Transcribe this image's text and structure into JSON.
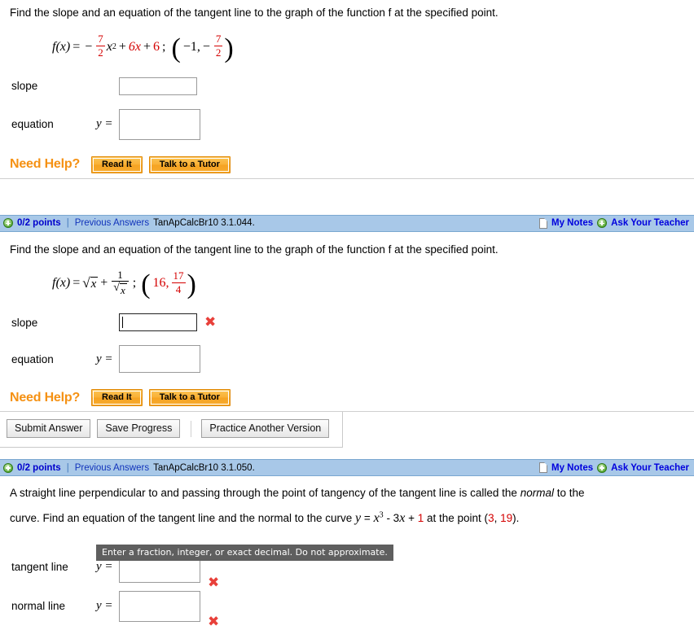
{
  "colors": {
    "header_bar": "#a8c8e8",
    "link": "#1133bb",
    "points": "#0000cc",
    "accent_orange": "#f59113",
    "math_red": "#d40000",
    "error_x": "#e8403a",
    "tooltip_bg": "#5f5f5f"
  },
  "problem1": {
    "prompt": "Find the slope and an equation of the tangent line to the graph of the function f at the specified point.",
    "formula": {
      "fx": "f(x)",
      "equals": "=",
      "minus": "−",
      "frac1_num": "7",
      "frac1_den": "2",
      "x_var": "x",
      "x_exp": "2",
      "plus1": "+",
      "term_6x": "6x",
      "plus2": "+",
      "term_6": "6",
      "semicolon": ";",
      "point_open": "(",
      "point_x": "−1,",
      "point_minus": "−",
      "point_frac_num": "7",
      "point_frac_den": "2",
      "point_close": ")"
    },
    "rows": [
      {
        "label": "slope",
        "eq": "",
        "value": ""
      },
      {
        "label": "equation",
        "eq": "y =",
        "value": ""
      }
    ],
    "need_help": {
      "label": "Need Help?",
      "buttons": [
        "Read It",
        "Talk to a Tutor"
      ]
    }
  },
  "section2": {
    "header": {
      "points": "0/2 points",
      "divider": "|",
      "previous_answers": "Previous Answers",
      "question_id": "TanApCalcBr10 3.1.044.",
      "my_notes": "My Notes",
      "ask_teacher": "Ask Your Teacher"
    },
    "prompt": "Find the slope and an equation of the tangent line to the graph of the function f at the specified point.",
    "formula": {
      "fx": "f(x)",
      "equals": "=",
      "sqrt_x": "x",
      "plus": "+",
      "frac_num": "1",
      "frac_den_sqrt": "x",
      "semicolon": ";",
      "point_open": "(",
      "point_x": "16,",
      "point_frac_num": "17",
      "point_frac_den": "4",
      "point_close": ")"
    },
    "rows": [
      {
        "label": "slope",
        "eq": "",
        "value": "",
        "status": "incorrect",
        "focused": true
      },
      {
        "label": "equation",
        "eq": "y =",
        "value": "",
        "status": "none",
        "focused": false
      }
    ],
    "tooltip": "Enter a fraction, integer, or exact decimal. Do not approximate.",
    "need_help": {
      "label": "Need Help?",
      "buttons": [
        "Read It",
        "Talk to a Tutor"
      ]
    },
    "actions": {
      "submit": "Submit Answer",
      "save": "Save Progress",
      "practice": "Practice Another Version"
    }
  },
  "section3": {
    "header": {
      "points": "0/2 points",
      "divider": "|",
      "previous_answers": "Previous Answers",
      "question_id": "TanApCalcBr10 3.1.050.",
      "my_notes": "My Notes",
      "ask_teacher": "Ask Your Teacher"
    },
    "prompt_line1_a": "A straight line perpendicular to and passing through the point of tangency of the tangent line is called the ",
    "prompt_line1_em": "normal",
    "prompt_line1_b": " to the",
    "prompt_line2_a": "curve. Find an equation of the tangent line and the normal to the curve ",
    "prompt_line2_y": "y",
    "prompt_line2_eq": "=",
    "prompt_line2_x": "x",
    "prompt_line2_exp": "3",
    "prompt_line2_b": "- 3",
    "prompt_line2_x2": "x",
    "prompt_line2_plus": "+",
    "prompt_line2_one": "1",
    "prompt_line2_c": " at the point (",
    "prompt_point_x": "3",
    "prompt_point_comma": ", ",
    "prompt_point_y": "19",
    "prompt_line2_d": ").",
    "rows": [
      {
        "label": "tangent line",
        "eq": "y =",
        "value": "",
        "status": "incorrect"
      },
      {
        "label": "normal line",
        "eq": "y =",
        "value": "",
        "status": "incorrect"
      }
    ]
  }
}
